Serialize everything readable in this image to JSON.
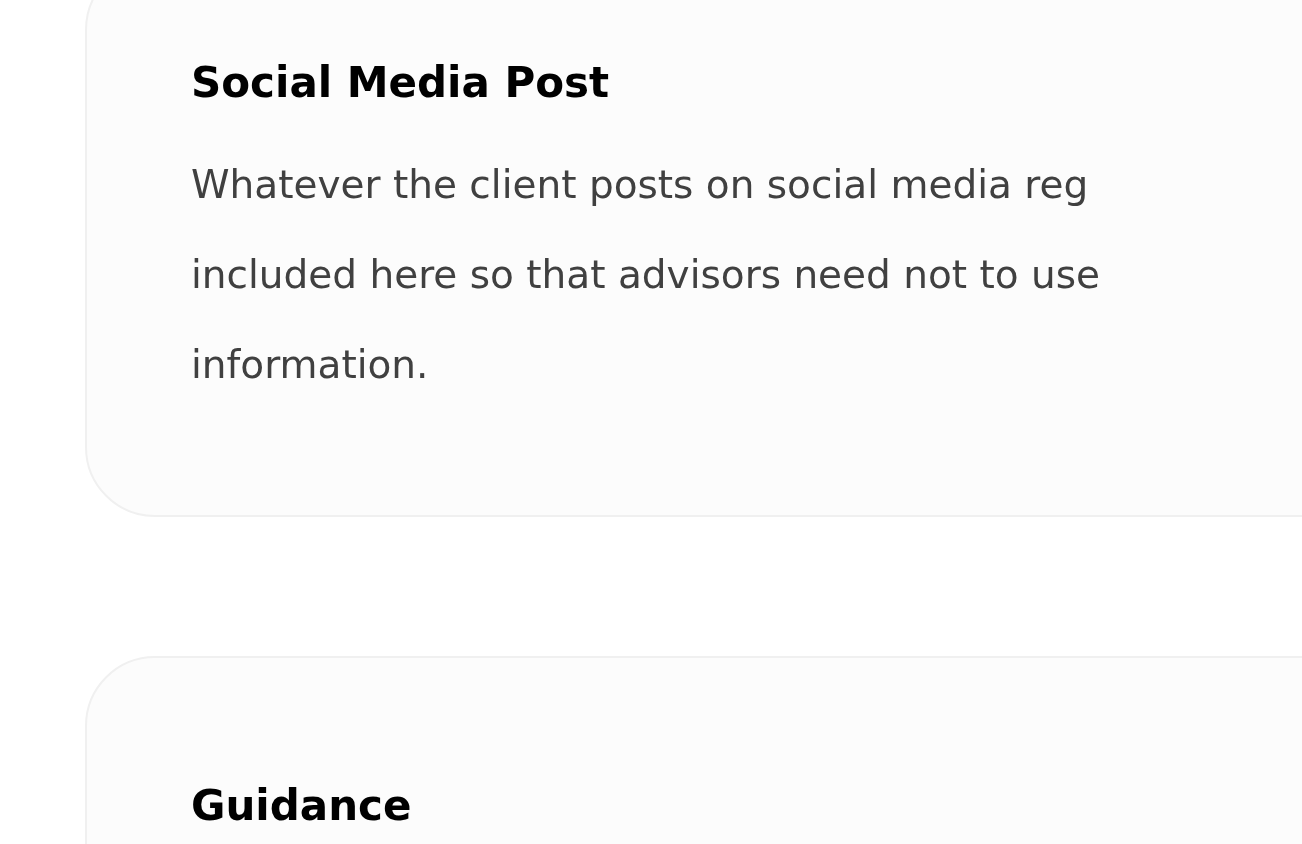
{
  "cards": [
    {
      "title": "Social Media Post",
      "body_lines": [
        "Whatever the client posts on social media reg",
        "included here so that advisors need not to use",
        "information."
      ]
    },
    {
      "title": "Guidance"
    }
  ]
}
